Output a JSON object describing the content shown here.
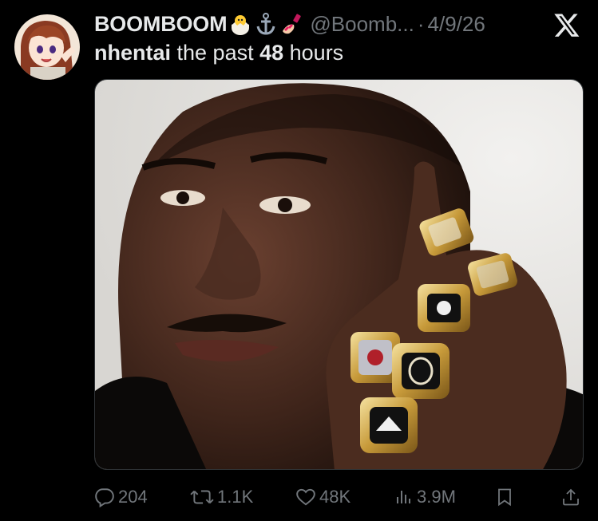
{
  "tweet": {
    "display_name": "BOOMBOOM",
    "name_emojis": [
      "hatching-chick-emoji",
      "anchor-emoji",
      "nail-polish-emoji"
    ],
    "handle": "@Boomb...",
    "separator": "·",
    "date": "4/9/26",
    "text_bold": "nhentai",
    "text_mid": " the past ",
    "text_bold2": "48",
    "text_end": " hours"
  },
  "actions": {
    "replies": "204",
    "retweets": "1.1K",
    "likes": "48K",
    "views": "3.9M"
  },
  "icons": {
    "top_right": "x-logo-icon",
    "reply": "reply-icon",
    "retweet": "retweet-icon",
    "like": "heart-icon",
    "views": "views-chart-icon",
    "bookmark": "bookmark-icon",
    "share": "share-icon"
  },
  "colors": {
    "background": "#000000",
    "text_primary": "#e7e9ea",
    "text_secondary": "#71767b",
    "media_border": "#2f3336"
  }
}
